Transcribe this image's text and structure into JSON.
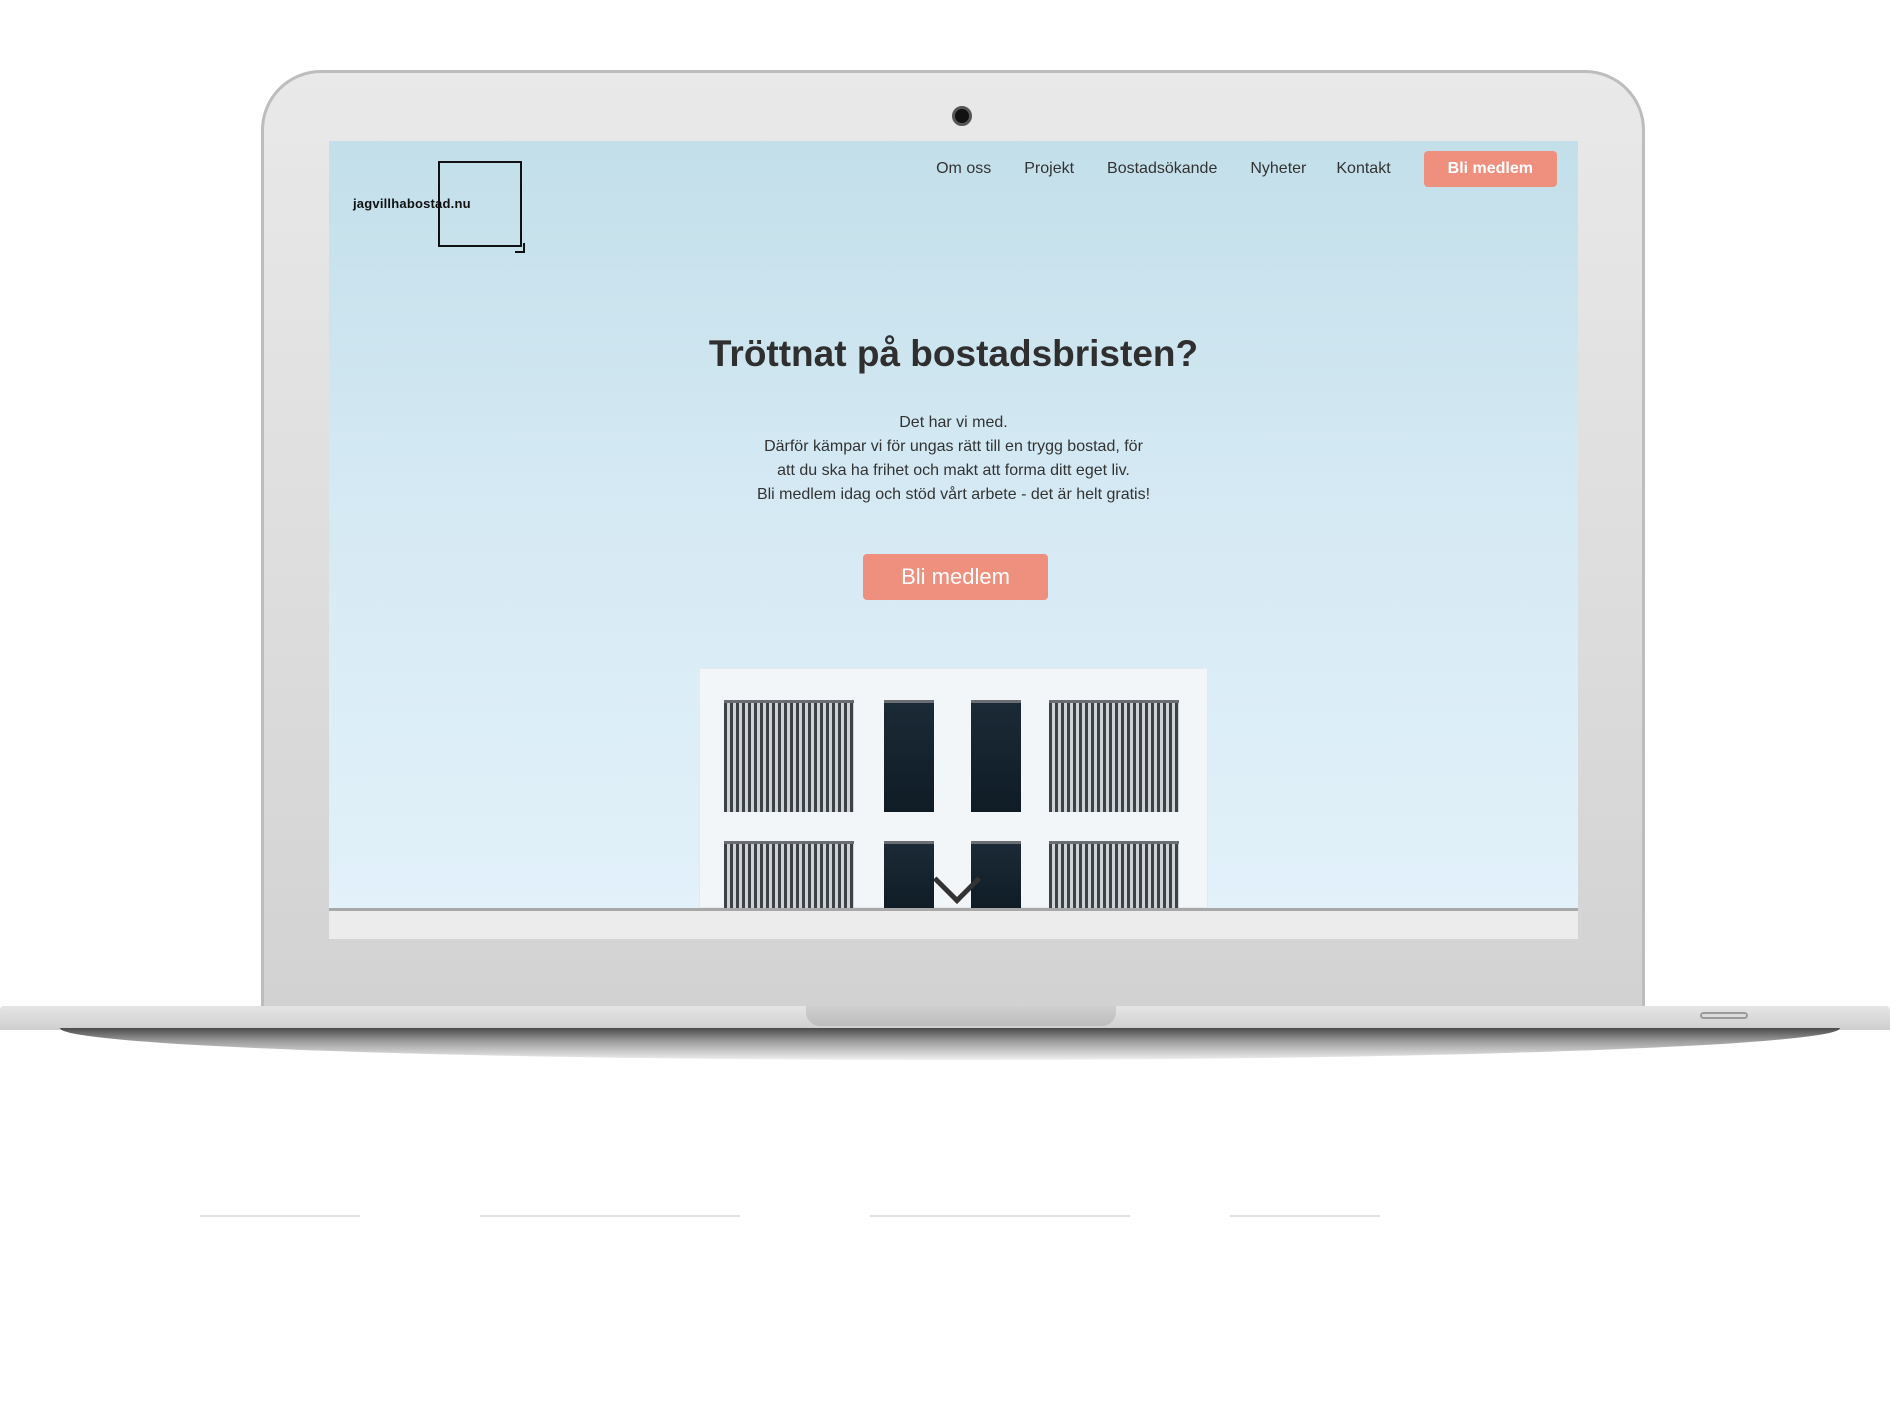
{
  "logo": {
    "text": "jagvillhabostad.nu"
  },
  "nav": {
    "links": [
      "Om oss",
      "Projekt",
      "Bostadsökande",
      "Nyheter",
      "Kontakt"
    ],
    "cta": "Bli medlem"
  },
  "hero": {
    "title": "Tröttnat på bostadsbristen?",
    "lines": [
      "Det har vi med.",
      "Därför kämpar vi för ungas rätt till en trygg bostad, för",
      "att du ska ha frihet och makt att forma ditt eget liv.",
      "Bli medlem idag och stöd vårt arbete - det är helt gratis!"
    ],
    "cta": "Bli medlem"
  },
  "icons": {
    "scroll": "chevron-down-icon"
  },
  "colors": {
    "accent": "#ef907e",
    "sky_top": "#c3dfea",
    "sky_bottom": "#e2f1fa",
    "text": "#2f2f2f"
  }
}
